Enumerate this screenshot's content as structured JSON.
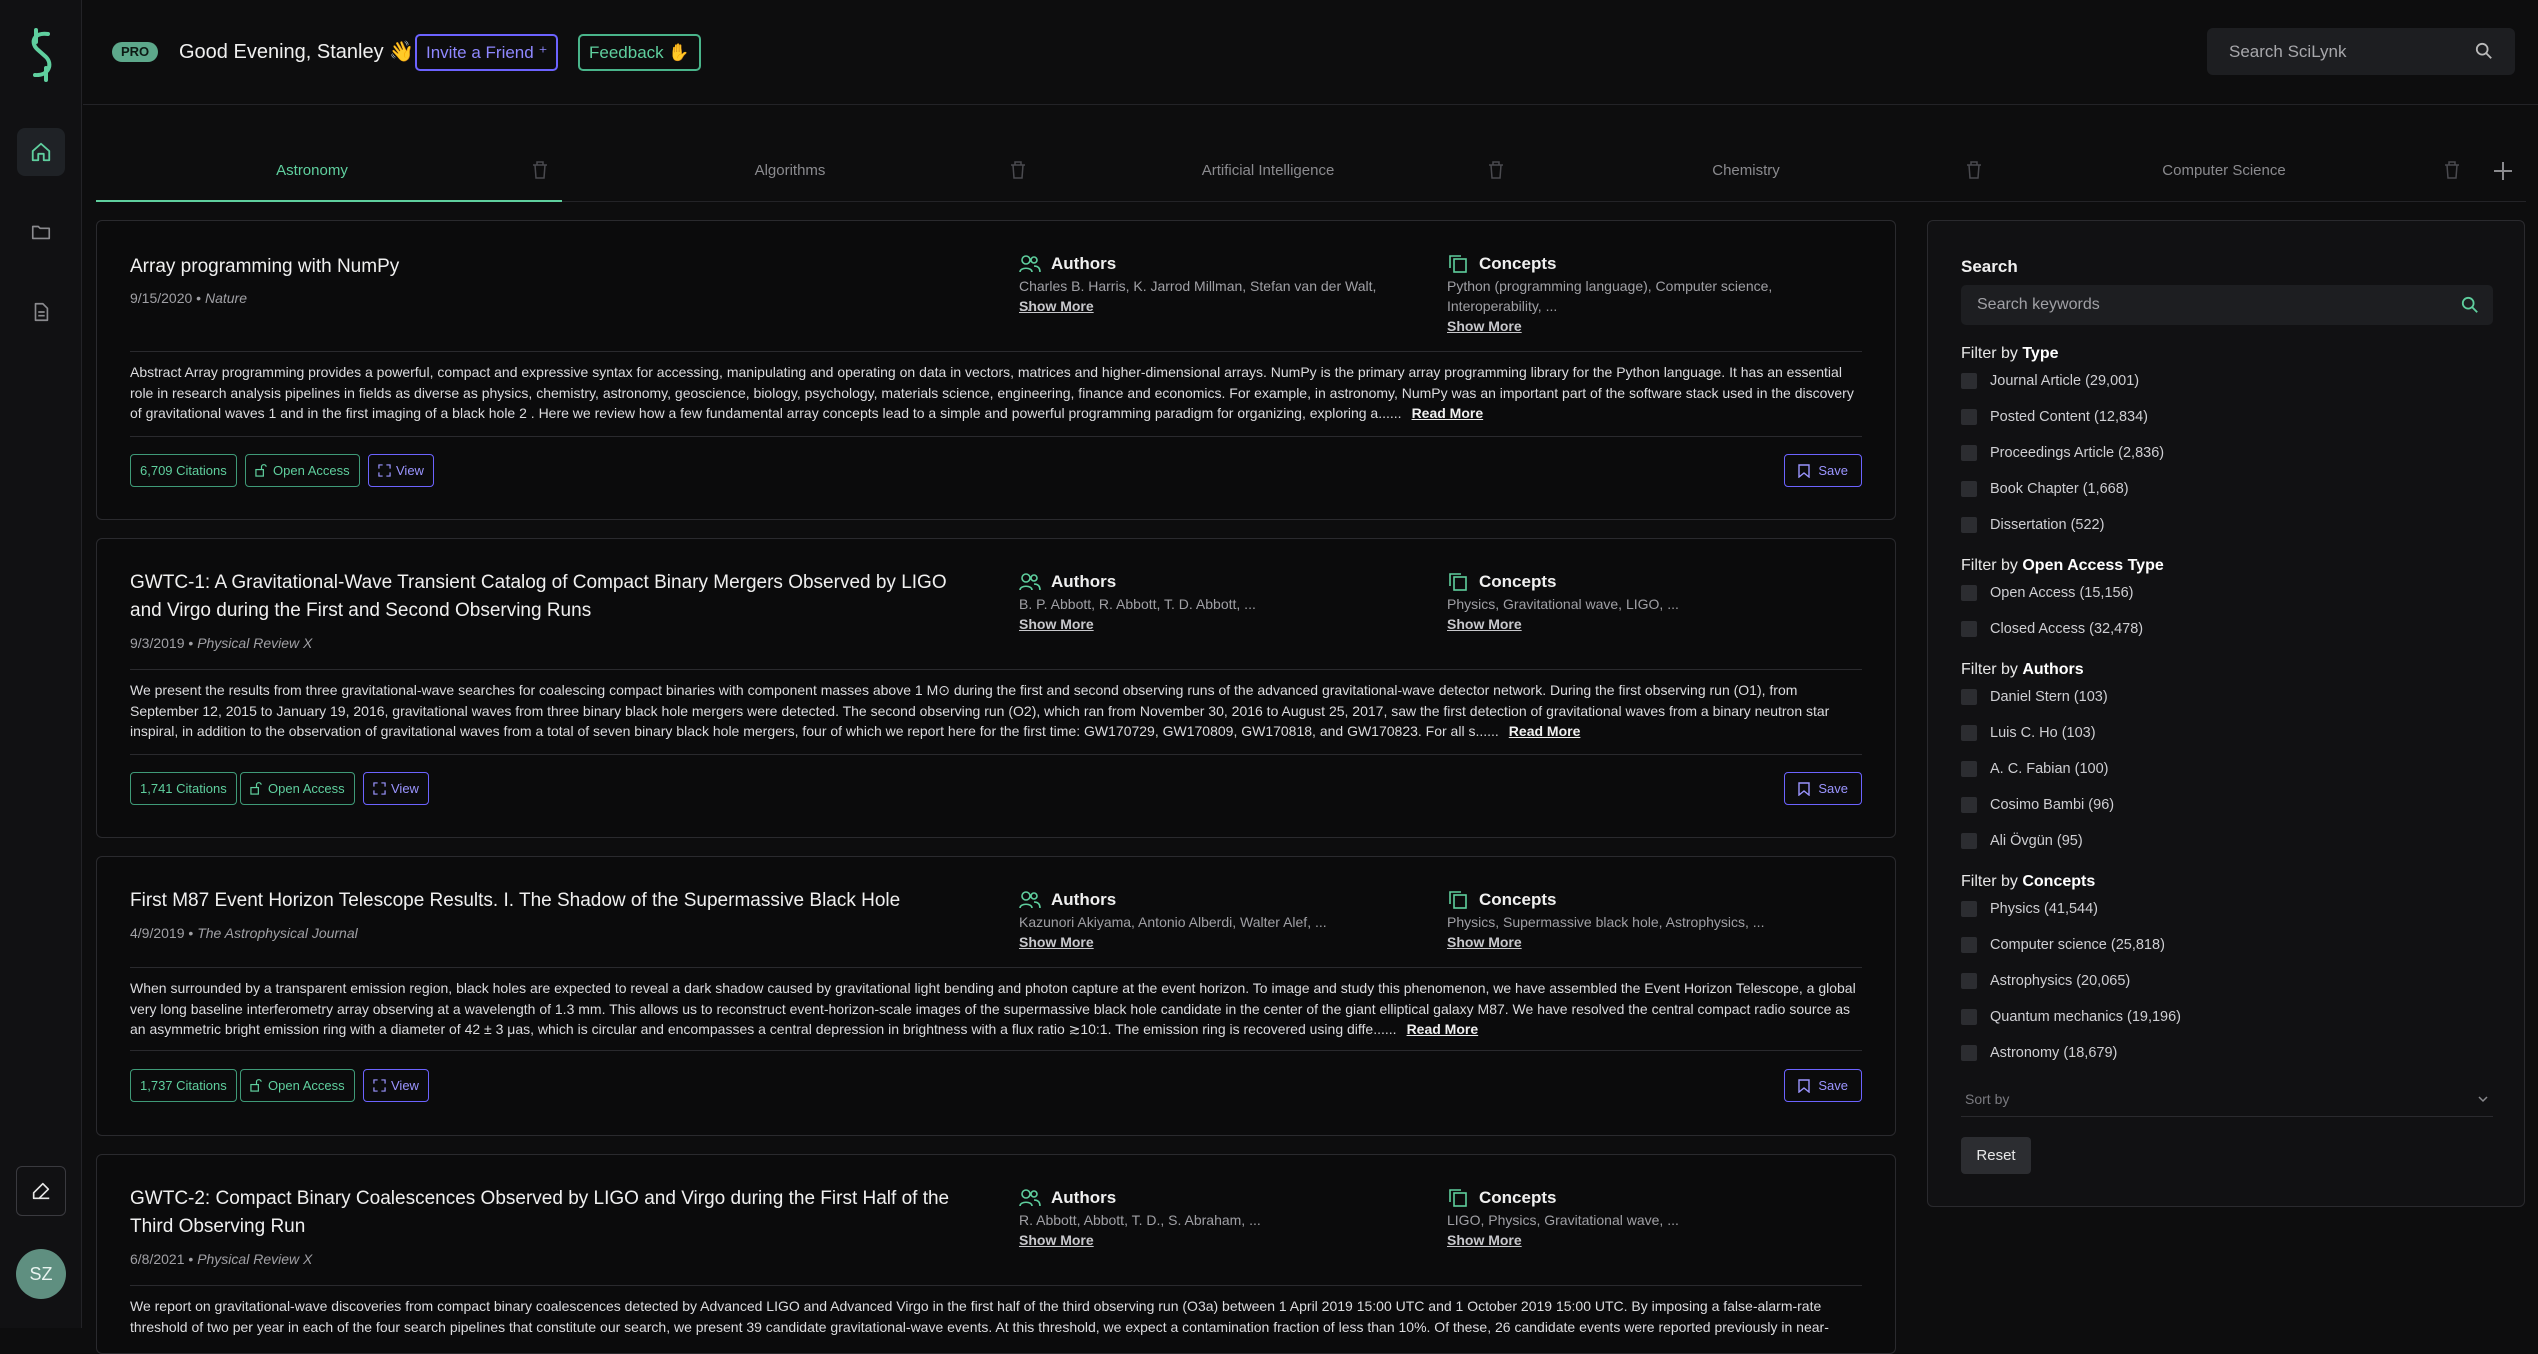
{
  "header": {
    "pro_badge": "PRO",
    "greeting": "Good Evening, Stanley 👋",
    "invite_label": "Invite a Friend",
    "feedback_label": "Feedback",
    "search_placeholder": "Search SciLynk"
  },
  "sidebar": {
    "avatar_initials": "SZ",
    "items": [
      {
        "icon": "home-icon",
        "active": true
      },
      {
        "icon": "folder-icon",
        "active": false
      },
      {
        "icon": "document-icon",
        "active": false
      }
    ]
  },
  "tabs": [
    {
      "label": "Astronomy",
      "active": true
    },
    {
      "label": "Algorithms"
    },
    {
      "label": "Artificial Intelligence"
    },
    {
      "label": "Chemistry"
    },
    {
      "label": "Computer Science"
    }
  ],
  "labels": {
    "authors": "Authors",
    "concepts": "Concepts",
    "show_more": "Show More",
    "read_more": "Read More",
    "open_access": "Open Access",
    "view": "View",
    "save": "Save"
  },
  "papers": [
    {
      "title": "Array programming with NumPy",
      "date": "9/15/2020",
      "journal": "Nature",
      "authors": "Charles B. Harris, K. Jarrod Millman, Stefan van der Walt, ...",
      "concepts": "Python (programming language), Computer science, Interoperability, ...",
      "abstract": "Abstract Array programming provides a powerful, compact and expressive syntax for accessing, manipulating and operating on data in vectors, matrices and higher-dimensional arrays. NumPy is the primary array programming library for the Python language. It has an essential role in research analysis pipelines in fields as diverse as physics, chemistry, astronomy, geoscience, biology, psychology, materials science, engineering, finance and economics. For example, in astronomy, NumPy was an important part of the software stack used in the discovery of gravitational waves 1 and in the first imaging of a black hole 2 . Here we review how a few fundamental array concepts lead to a simple and powerful programming paradigm for organizing, exploring a......",
      "citations": "6,709 Citations"
    },
    {
      "title": "GWTC-1: A Gravitational-Wave Transient Catalog of Compact Binary Mergers Observed by LIGO and Virgo during the First and Second Observing Runs",
      "date": "9/3/2019",
      "journal": "Physical Review X",
      "authors": "B. P. Abbott, R. Abbott, T. D. Abbott, ...",
      "concepts": "Physics, Gravitational wave, LIGO, ...",
      "abstract": "We present the results from three gravitational-wave searches for coalescing compact binaries with component masses above 1 M⊙ during the first and second observing runs of the advanced gravitational-wave detector network. During the first observing run (O1), from September 12, 2015 to January 19, 2016, gravitational waves from three binary black hole mergers were detected. The second observing run (O2), which ran from November 30, 2016 to August 25, 2017, saw the first detection of gravitational waves from a binary neutron star inspiral, in addition to the observation of gravitational waves from a total of seven binary black hole mergers, four of which we report here for the first time: GW170729, GW170809, GW170818, and GW170823. For all s......",
      "citations": "1,741 Citations"
    },
    {
      "title": "First M87 Event Horizon Telescope Results. I. The Shadow of the Supermassive Black Hole",
      "date": "4/9/2019",
      "journal": "The Astrophysical Journal",
      "authors": "Kazunori Akiyama, Antonio Alberdi, Walter Alef, ...",
      "concepts": "Physics, Supermassive black hole, Astrophysics, ...",
      "abstract": "When surrounded by a transparent emission region, black holes are expected to reveal a dark shadow caused by gravitational light bending and photon capture at the event horizon. To image and study this phenomenon, we have assembled the Event Horizon Telescope, a global very long baseline interferometry array observing at a wavelength of 1.3 mm. This allows us to reconstruct event-horizon-scale images of the supermassive black hole candidate in the center of the giant elliptical galaxy M87. We have resolved the central compact radio source as an asymmetric bright emission ring with a diameter of 42 ± 3 μas, which is circular and encompasses a central depression in brightness with a flux ratio ≳10:1. The emission ring is recovered using diffe......",
      "citations": "1,737 Citations"
    },
    {
      "title": "GWTC-2: Compact Binary Coalescences Observed by LIGO and Virgo during the First Half of the Third Observing Run",
      "date": "6/8/2021",
      "journal": "Physical Review X",
      "authors": "R. Abbott, Abbott, T. D., S. Abraham, ...",
      "concepts": "LIGO, Physics, Gravitational wave, ...",
      "abstract": "We report on gravitational-wave discoveries from compact binary coalescences detected by Advanced LIGO and Advanced Virgo in the first half of the third observing run (O3a) between 1 April 2019 15:00 UTC and 1 October 2019 15:00 UTC. By imposing a false-alarm-rate threshold of two per year in each of the four search pipelines that constitute our search, we present 39 candidate gravitational-wave events. At this threshold, we expect a contamination fraction of less than 10%. Of these, 26 candidate events were reported previously in near-",
      "citations": ""
    }
  ],
  "filters": {
    "title": "Search",
    "search_placeholder": "Search keywords",
    "groups": [
      {
        "prefix": "Filter by ",
        "name": "Type",
        "items": [
          "Journal Article (29,001)",
          "Posted Content (12,834)",
          "Proceedings Article (2,836)",
          "Book Chapter (1,668)",
          "Dissertation (522)"
        ]
      },
      {
        "prefix": "Filter by ",
        "name": "Open Access Type",
        "items": [
          "Open Access (15,156)",
          "Closed Access (32,478)"
        ]
      },
      {
        "prefix": "Filter by ",
        "name": "Authors",
        "items": [
          "Daniel Stern (103)",
          "Luis C. Ho (103)",
          "A. C. Fabian (100)",
          "Cosimo Bambi (96)",
          "Ali Övgün (95)"
        ]
      },
      {
        "prefix": "Filter by ",
        "name": "Concepts",
        "items": [
          "Physics (41,544)",
          "Computer science (25,818)",
          "Astrophysics (20,065)",
          "Quantum mechanics (19,196)",
          "Astronomy (18,679)"
        ]
      }
    ],
    "sort_by": "Sort by",
    "reset": "Reset"
  }
}
